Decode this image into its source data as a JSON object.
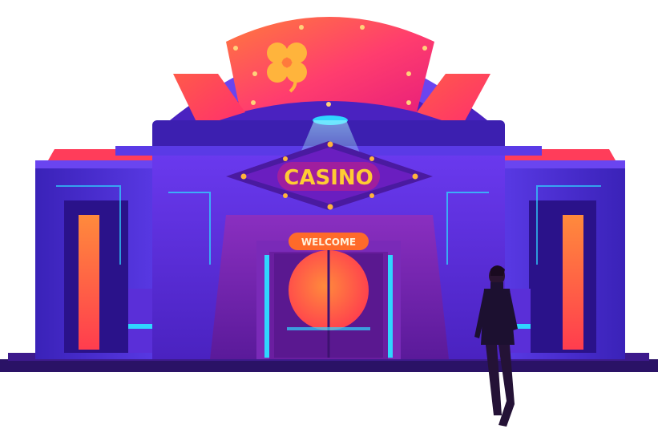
{
  "scene": {
    "sign_text": "CASINO",
    "welcome_text": "WELCOME",
    "logo_icon": "four-leaf-clover-icon",
    "colors": {
      "building_dark": "#3c1fb0",
      "building_mid": "#4e2fd6",
      "building_light": "#6a45f0",
      "facade_purple": "#5a1fa8",
      "crown_pink": "#ff3d6e",
      "crown_orange": "#ff7a3c",
      "accent_cyan": "#2fd6ff",
      "sign_text": "#ffcc33",
      "welcome_bg": "#ff6a2a",
      "ground": "#2a1266",
      "figure": "#1c1030"
    }
  }
}
